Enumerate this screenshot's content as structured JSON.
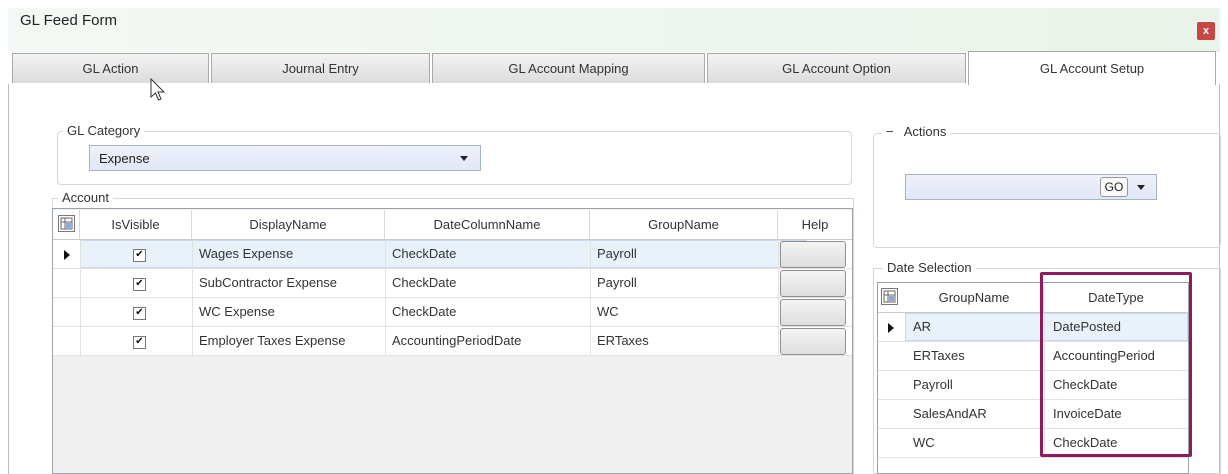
{
  "window": {
    "title": "GL Feed Form",
    "close_label": "x"
  },
  "tabs": [
    {
      "label": "GL Action",
      "active": false
    },
    {
      "label": "Journal Entry",
      "active": false
    },
    {
      "label": "GL Account Mapping",
      "active": false
    },
    {
      "label": "GL Account Option",
      "active": false
    },
    {
      "label": "GL Account Setup",
      "active": true
    }
  ],
  "gl_category": {
    "label": "GL Category",
    "selected": "Expense"
  },
  "account": {
    "label": "Account",
    "columns": [
      "IsVisible",
      "DisplayName",
      "DateColumnName",
      "GroupName",
      "Help"
    ],
    "rows": [
      {
        "is_visible": true,
        "display_name": "Wages Expense",
        "date_column": "CheckDate",
        "group": "Payroll"
      },
      {
        "is_visible": true,
        "display_name": "SubContractor Expense",
        "date_column": "CheckDate",
        "group": "Payroll"
      },
      {
        "is_visible": true,
        "display_name": "WC Expense",
        "date_column": "CheckDate",
        "group": "WC"
      },
      {
        "is_visible": true,
        "display_name": "Employer Taxes Expense",
        "date_column": "AccountingPeriodDate",
        "group": "ERTaxes"
      }
    ]
  },
  "actions": {
    "collapse_symbol": "−",
    "label": "Actions",
    "value": "",
    "go_label": "GO"
  },
  "date_selection": {
    "label": "Date Selection",
    "columns": [
      "GroupName",
      "DateType"
    ],
    "rows": [
      {
        "group": "AR",
        "date_type": "DatePosted"
      },
      {
        "group": "ERTaxes",
        "date_type": "AccountingPeriod"
      },
      {
        "group": "Payroll",
        "date_type": "CheckDate"
      },
      {
        "group": "SalesAndAR",
        "date_type": "InvoiceDate"
      },
      {
        "group": "WC",
        "date_type": "CheckDate"
      }
    ]
  },
  "colors": {
    "highlight": "#8e1c5c",
    "close_button": "#c74646",
    "select_bg": "#e2e7f7"
  }
}
